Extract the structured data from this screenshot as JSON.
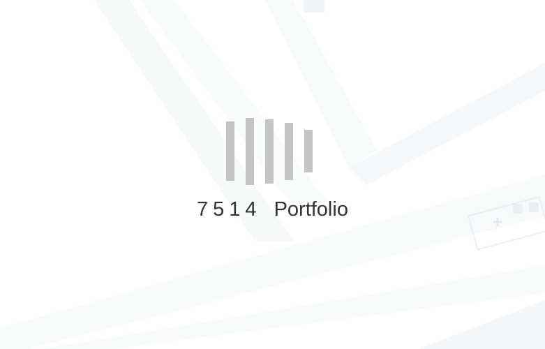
{
  "loading_screen": {
    "number": "7514",
    "label": "Portfolio",
    "bar_color": "#c4c4c4",
    "text_color": "#333333",
    "bar_count": 5
  }
}
